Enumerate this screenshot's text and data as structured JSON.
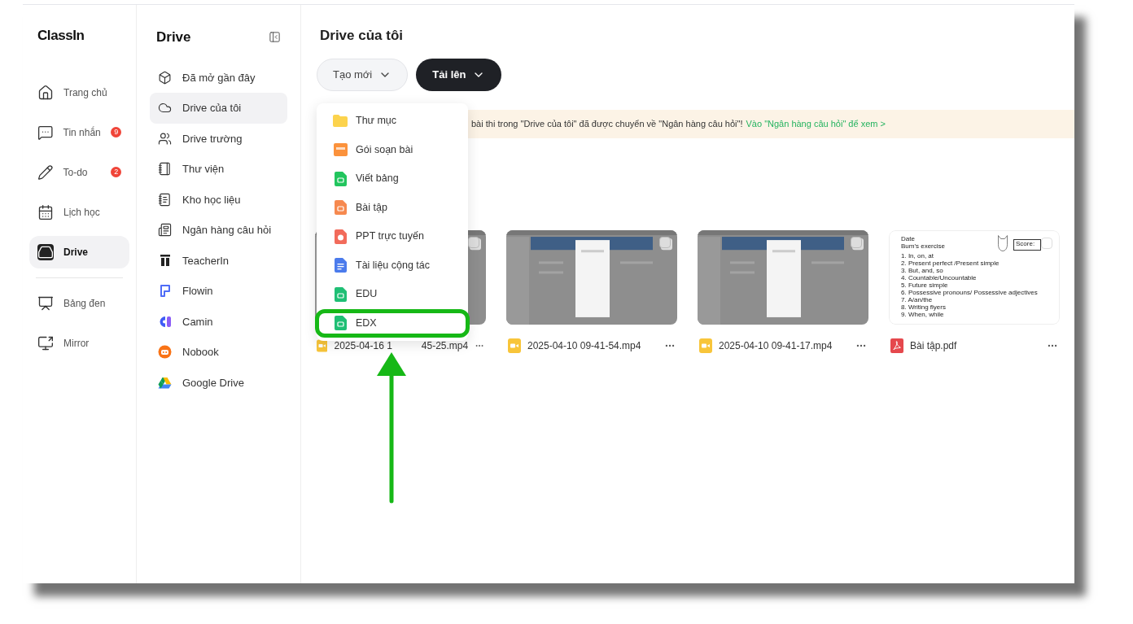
{
  "nav": {
    "logo": "ClassIn",
    "items": [
      {
        "kind": "home",
        "label": "Trang chủ",
        "selected": false
      },
      {
        "kind": "chat",
        "label": "Tin nhắn",
        "badge": "9",
        "selected": false
      },
      {
        "kind": "todo",
        "label": "To-do",
        "badge": "2",
        "selected": false
      },
      {
        "kind": "calendar",
        "label": "Lịch học",
        "selected": false
      },
      {
        "kind": "drive",
        "label": "Drive",
        "selected": true
      }
    ],
    "bottom_items": [
      {
        "kind": "board",
        "label": "Bảng đen",
        "selected": false
      },
      {
        "kind": "mirror",
        "label": "Mirror",
        "selected": false
      }
    ]
  },
  "sidebar": {
    "title": "Drive",
    "items": [
      {
        "kind": "recent",
        "label": "Đã mở gần đây",
        "selected": false
      },
      {
        "kind": "cloud",
        "label": "Drive của tôi",
        "selected": true
      },
      {
        "kind": "team",
        "label": "Drive trường",
        "selected": false
      },
      {
        "kind": "library",
        "label": "Thư viện",
        "selected": false
      },
      {
        "kind": "materials",
        "label": "Kho học liệu",
        "selected": false
      },
      {
        "kind": "bank",
        "label": "Ngân hàng câu hỏi",
        "selected": false
      },
      {
        "kind": "teacherin",
        "label": "TeacherIn",
        "selected": false
      },
      {
        "kind": "flowin",
        "label": "Flowin",
        "selected": false
      },
      {
        "kind": "camin",
        "label": "Camin",
        "selected": false
      },
      {
        "kind": "nobook",
        "label": "Nobook",
        "selected": false
      },
      {
        "kind": "gdrive",
        "label": "Google Drive",
        "selected": false
      }
    ]
  },
  "main": {
    "title": "Drive của tôi",
    "buttons": [
      {
        "label": "Tạo mới",
        "kind": "light"
      },
      {
        "label": "Tải lên",
        "kind": "dark"
      }
    ],
    "banner": {
      "text": "bài thi trong \"Drive của tôi\" đã được chuyển về \"Ngân hàng câu hỏi\"!",
      "link": "Vào \"Ngân hàng câu hỏi\" để xem >"
    },
    "new_menu": [
      {
        "kind": "folder",
        "label": "Thư mục",
        "highlighted": false
      },
      {
        "kind": "package",
        "label": "Gói soạn bài",
        "highlighted": false
      },
      {
        "kind": "whiteboard",
        "label": "Viết bảng",
        "highlighted": false
      },
      {
        "kind": "exercise",
        "label": "Bài tập",
        "highlighted": false
      },
      {
        "kind": "ppt",
        "label": "PPT trực tuyến",
        "highlighted": false
      },
      {
        "kind": "document",
        "label": "Tài liệu cộng tác",
        "highlighted": false
      },
      {
        "kind": "edu",
        "label": "EDU",
        "highlighted": false
      },
      {
        "kind": "edx",
        "label": "EDX",
        "highlighted": true
      }
    ],
    "files": [
      {
        "kind": "video",
        "name": "2025-04-16 1",
        "name_tail": "45-25.mp4",
        "checked": false
      },
      {
        "kind": "video",
        "name": "2025-04-10 09-41-54.mp4",
        "checked": false
      },
      {
        "kind": "video",
        "name": "2025-04-10 09-41-17.mp4",
        "checked": false
      },
      {
        "kind": "pdf",
        "name": "Bài tập.pdf",
        "checked": false,
        "preview": {
          "header": [
            "Date",
            "Bum's exercise"
          ],
          "score": "Score:",
          "lines": [
            "1. In, on, at",
            "2. Present perfect /Present simple",
            "3. But, and, so",
            "4. Countable/Uncountable",
            "5. Future simple",
            "6. Possessive pronouns/ Possessive adjectives",
            "7. A/an/the",
            "8. Writing flyers",
            "9. When, while"
          ]
        }
      }
    ]
  }
}
